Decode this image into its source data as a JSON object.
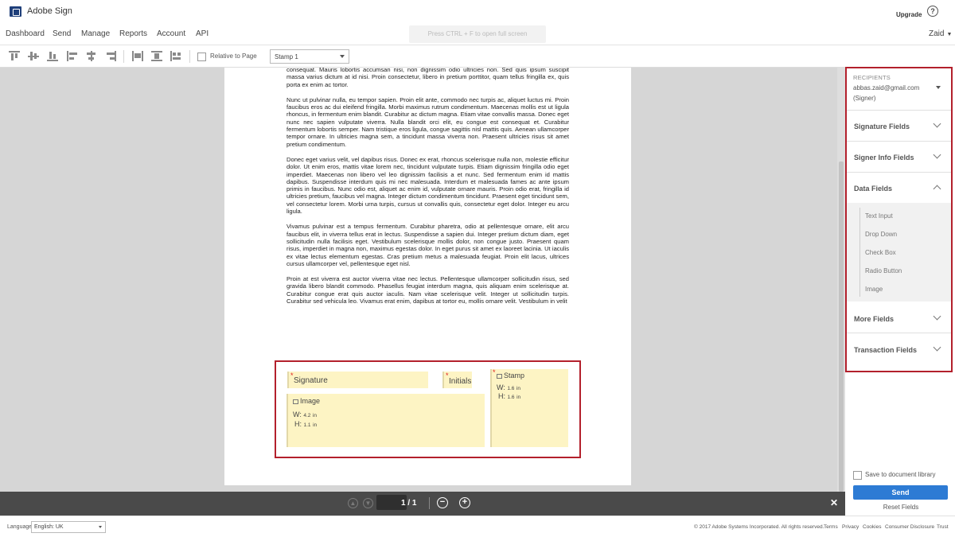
{
  "header": {
    "app_title": "Adobe Sign",
    "upgrade": "Upgrade",
    "help_icon": "?"
  },
  "nav": {
    "items": [
      "Dashboard",
      "Send",
      "Manage",
      "Reports",
      "Account",
      "API"
    ],
    "user": "Zaid",
    "ghost_text": "Press CTRL  + F to open full screen"
  },
  "toolbar": {
    "relative_to_page": "Relative to Page",
    "stamp_select": "Stamp 1"
  },
  "document": {
    "paragraphs": [
      "consequat. Mauris lobortis accumsan nisi, non dignissim odio ultricies non. Sed quis ipsum suscipit massa varius dictum at id nisi. Proin consectetur, libero in pretium porttitor, quam tellus fringilla ex, quis porta ex enim ac tortor.",
      "Nunc ut pulvinar nulla, eu tempor sapien. Proin elit ante, commodo nec turpis ac, aliquet luctus mi. Proin faucibus eros ac dui eleifend fringilla. Morbi maximus rutrum condimentum. Maecenas mollis est ut ligula rhoncus, in fermentum enim blandit. Curabitur ac dictum magna. Etiam vitae convallis massa. Donec eget nunc nec sapien vulputate viverra. Nulla blandit orci elit, eu congue est consequat et. Curabitur fermentum lobortis semper. Nam tristique eros ligula, congue sagittis nisl mattis quis. Aenean ullamcorper tempor ornare. In ultricies magna sem, a tincidunt massa viverra non. Praesent ultricies risus sit amet pretium condimentum.",
      "Donec eget varius velit, vel dapibus risus. Donec ex erat, rhoncus scelerisque nulla non, molestie efficitur dolor. Ut enim eros, mattis vitae lorem nec, tincidunt vulputate turpis. Etiam dignissim fringilla odio eget imperdiet. Maecenas non libero vel leo dignissim facilisis a et nunc. Sed fermentum enim id mattis dapibus. Suspendisse interdum quis mi nec malesuada. Interdum et malesuada fames ac ante ipsum primis in faucibus. Nunc odio est, aliquet ac enim id, vulputate ornare mauris. Proin odio erat, fringilla id ultricies pretium, faucibus vel magna. Integer dictum condimentum tincidunt. Praesent eget tincidunt sem, vel consectetur lorem. Morbi urna turpis, cursus ut convallis quis, consectetur eget dolor. Integer eu arcu ligula.",
      "Vivamus pulvinar est a tempus fermentum. Curabitur pharetra, odio at pellentesque ornare, elit arcu faucibus elit, in viverra tellus erat in lectus. Suspendisse a sapien dui. Integer pretium dictum diam, eget sollicitudin nulla facilisis eget. Vestibulum scelerisque mollis dolor, non congue justo. Praesent quam risus, imperdiet in magna non, maximus egestas dolor. In eget purus sit amet ex laoreet lacinia. Ut iaculis ex vitae lectus elementum egestas. Cras pretium metus a malesuada feugiat. Proin elit lacus, ultrices cursus ullamcorper vel, pellentesque eget nisl.",
      "Proin at est viverra est auctor viverra vitae nec lectus. Pellentesque ullamcorper sollicitudin risus, sed gravida libero blandit commodo. Phasellus feugiat interdum magna, quis aliquam enim scelerisque at. Curabitur congue erat quis auctor iaculis. Nam vitae scelerisque velit. Integer ut sollicitudin turpis. Curabitur sed vehicula leo. Vivamus erat enim, dapibus at tortor eu, mollis ornare velit. Vestibulum in velit"
    ],
    "fields": {
      "signature": "Signature",
      "initials": "Initials",
      "stamp": "Stamp",
      "stamp_w_label": "W:",
      "stamp_w": "1.6",
      "stamp_h_label": "H:",
      "stamp_h": "1.6",
      "image": "Image",
      "image_w_label": "W:",
      "image_w": "4.2",
      "image_h_label": "H:",
      "image_h": "1.1",
      "unit": "in",
      "required_mark": "*"
    }
  },
  "pagebar": {
    "page": "1 / 1",
    "prev_icon": "arrow-up",
    "next_icon": "arrow-down",
    "zoom_out": "−",
    "zoom_in": "+",
    "close": "✕"
  },
  "panel": {
    "recipients_header": "RECIPIENTS",
    "email": "abbas.zaid@gmail.com",
    "role": "(Signer)",
    "sections": [
      "Signature Fields",
      "Signer Info Fields",
      "Data Fields",
      "More Fields",
      "Transaction Fields"
    ],
    "data_fields": [
      "Text Input",
      "Drop Down",
      "Check Box",
      "Radio Button",
      "Image"
    ],
    "save_library": "Save to document library",
    "send": "Send",
    "reset": "Reset Fields"
  },
  "footer": {
    "language_label": "Language",
    "language_value": "English: UK",
    "copyright": "© 2017 Adobe Systems Incorporated. All rights reserved.",
    "links": [
      "Terms",
      "Privacy",
      "Cookies",
      "Consumer Disclosure",
      "Trust"
    ]
  },
  "colors": {
    "accent": "#2d7bd4",
    "highlight_outline": "#b3202c",
    "field_fill": "#fdf4c4"
  }
}
